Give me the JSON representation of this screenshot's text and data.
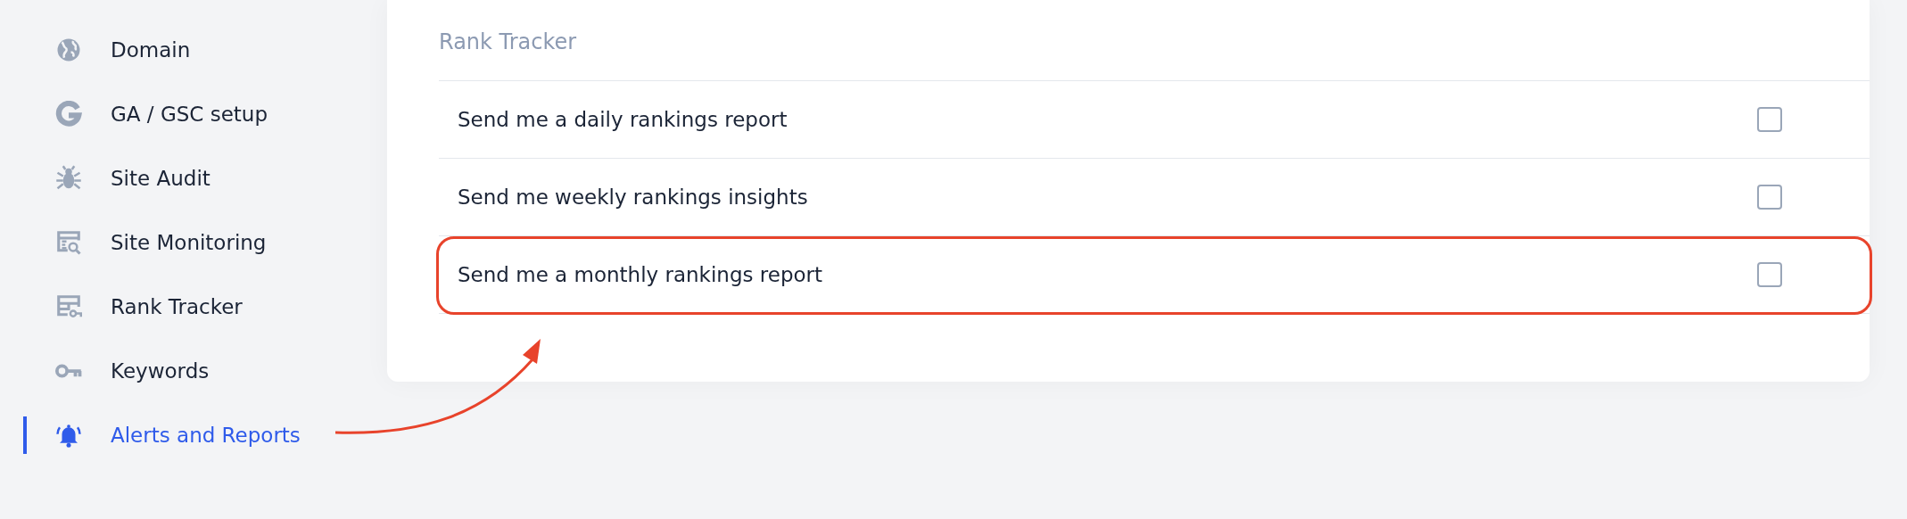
{
  "sidebar": {
    "items": [
      {
        "label": "Domain",
        "selected": false
      },
      {
        "label": "GA / GSC setup",
        "selected": false
      },
      {
        "label": "Site Audit",
        "selected": false
      },
      {
        "label": "Site Monitoring",
        "selected": false
      },
      {
        "label": "Rank Tracker",
        "selected": false
      },
      {
        "label": "Keywords",
        "selected": false
      },
      {
        "label": "Alerts and Reports",
        "selected": true
      }
    ]
  },
  "panel": {
    "title": "Rank Tracker",
    "options": [
      {
        "label": "Send me a daily rankings report",
        "checked": false,
        "highlighted": false
      },
      {
        "label": "Send me weekly rankings insights",
        "checked": false,
        "highlighted": false
      },
      {
        "label": "Send me a monthly rankings report",
        "checked": false,
        "highlighted": true
      }
    ]
  },
  "annotation": {
    "arrow": true
  }
}
